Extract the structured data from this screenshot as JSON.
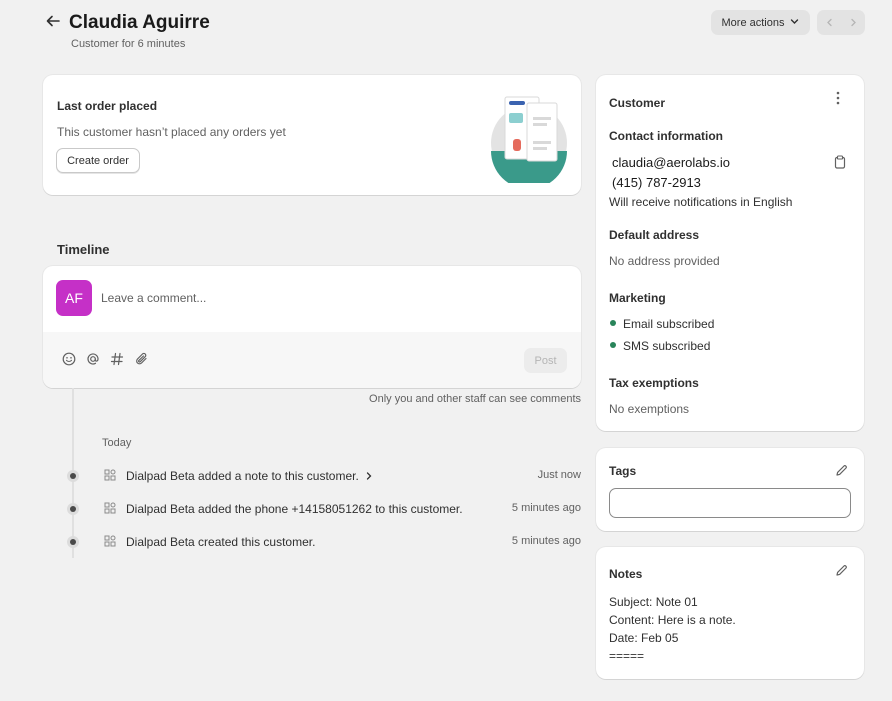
{
  "header": {
    "title": "Claudia Aguirre",
    "subtitle": "Customer for 6 minutes",
    "more_actions_label": "More actions"
  },
  "last_order": {
    "title": "Last order placed",
    "text": "This customer hasn’t placed any orders yet",
    "create_order_label": "Create order"
  },
  "timeline": {
    "title": "Timeline",
    "avatar_initials": "AF",
    "comment_placeholder": "Leave a comment...",
    "post_label": "Post",
    "visibility_note": "Only you and other staff can see comments",
    "day_label": "Today",
    "events": [
      {
        "text": "Dialpad Beta added a note to this customer.",
        "time": "Just now",
        "expandable": true
      },
      {
        "text": "Dialpad Beta added the phone +14158051262 to this customer.",
        "time": "5 minutes ago",
        "expandable": false
      },
      {
        "text": "Dialpad Beta created this customer.",
        "time": "5 minutes ago",
        "expandable": false
      }
    ]
  },
  "customer": {
    "title": "Customer",
    "contact_heading": "Contact information",
    "email": "claudia@aerolabs.io",
    "phone": "(415) 787-2913",
    "notification_language": "Will receive notifications in English",
    "address_heading": "Default address",
    "address_text": "No address provided",
    "marketing_heading": "Marketing",
    "marketing": [
      "Email subscribed",
      "SMS subscribed"
    ],
    "tax_heading": "Tax exemptions",
    "tax_text": "No exemptions"
  },
  "tags": {
    "title": "Tags"
  },
  "notes": {
    "title": "Notes",
    "lines": [
      "Subject: Note 01",
      "Content: Here is a note.",
      "Date: Feb 05",
      "====="
    ]
  },
  "colors": {
    "avatar": "#c530c7",
    "subscribed": "#29845a",
    "background": "#f1f1f1"
  }
}
